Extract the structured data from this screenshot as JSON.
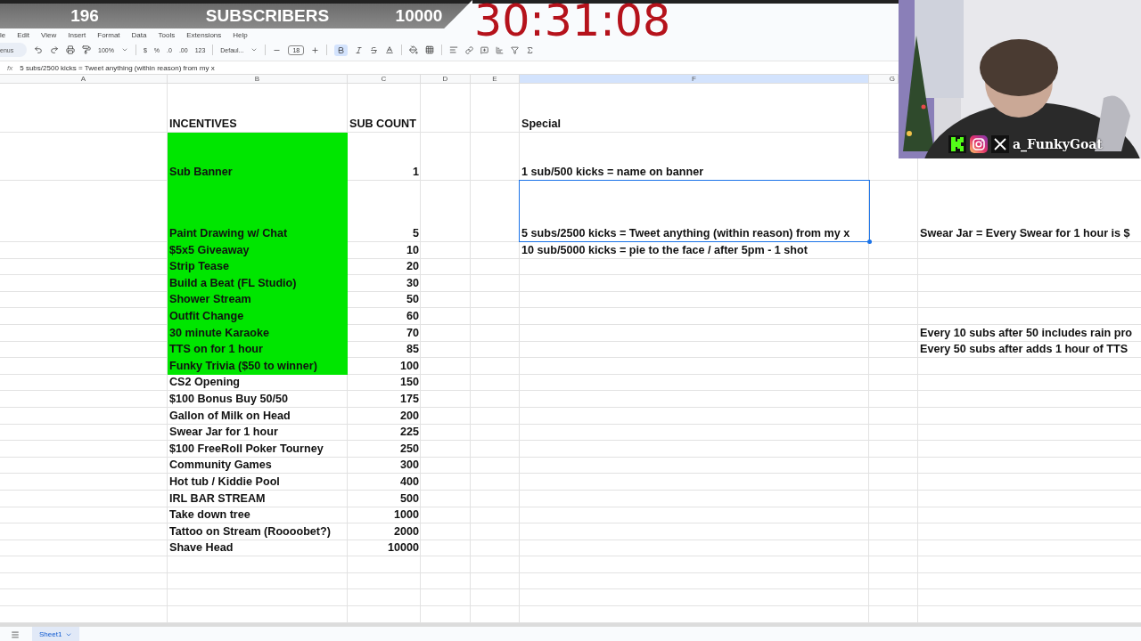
{
  "overlay": {
    "count": "196",
    "label": "SUBSCRIBERS",
    "goal": "10000",
    "timer": "30:31:08"
  },
  "menu": [
    "le",
    "Edit",
    "View",
    "Insert",
    "Format",
    "Data",
    "Tools",
    "Extensions",
    "Help"
  ],
  "toolbar": {
    "search": "enus",
    "zoom": "100%",
    "currency": "$",
    "percent": "%",
    "decrease_decimals": ".0",
    "increase_decimals": ".00",
    "number_format": "123",
    "font": "Defaul...",
    "font_size": "18",
    "bold": true
  },
  "formula_bar": {
    "fx": "fx",
    "content": "5 subs/2500 kicks = Tweet anything (within reason) from my x"
  },
  "columns": [
    {
      "label": "A",
      "selected": false
    },
    {
      "label": "B",
      "selected": false
    },
    {
      "label": "C",
      "selected": false
    },
    {
      "label": "D",
      "selected": false
    },
    {
      "label": "E",
      "selected": false
    },
    {
      "label": "F",
      "selected": true
    },
    {
      "label": "G",
      "selected": false
    }
  ],
  "rows": [
    {
      "kind": "header",
      "incentive": "INCENTIVES",
      "sub_count": "SUB COUNT",
      "special": "Special",
      "highlighted": false,
      "selected": false
    },
    {
      "kind": "banner",
      "incentive": "Sub Banner",
      "sub_count": "1",
      "special": "1 sub/500 kicks = name on banner",
      "highlighted": true,
      "selected": false
    },
    {
      "kind": "tall",
      "incentive": "Paint Drawing w/ Chat",
      "sub_count": "5",
      "special": "5 subs/2500 kicks = Tweet anything (within reason) from my x",
      "note": "Swear Jar = Every Swear for 1 hour is $",
      "highlighted": true,
      "selected": true
    },
    {
      "kind": "item",
      "incentive": "$5x5 Giveaway",
      "sub_count": "10",
      "special": "10 sub/5000 kicks = pie to the face / after 5pm - 1 shot",
      "highlighted": true,
      "selected": false
    },
    {
      "kind": "item",
      "incentive": "Strip Tease",
      "sub_count": "20",
      "highlighted": true,
      "selected": false
    },
    {
      "kind": "item",
      "incentive": "Build a Beat (FL Studio)",
      "sub_count": "30",
      "highlighted": true,
      "selected": false
    },
    {
      "kind": "item",
      "incentive": "Shower Stream",
      "sub_count": "50",
      "highlighted": true,
      "selected": false
    },
    {
      "kind": "item",
      "incentive": "Outfit Change",
      "sub_count": "60",
      "highlighted": true,
      "selected": false
    },
    {
      "kind": "item",
      "incentive": "30 minute Karaoke",
      "sub_count": "70",
      "note": "Every 10 subs after 50 includes rain pro",
      "highlighted": true,
      "selected": false
    },
    {
      "kind": "item",
      "incentive": "TTS on for 1 hour",
      "sub_count": "85",
      "note": "Every 50 subs after adds 1 hour of TTS",
      "highlighted": true,
      "selected": false
    },
    {
      "kind": "item",
      "incentive": "Funky Trivia ($50 to winner)",
      "sub_count": "100",
      "highlighted": true,
      "selected": false
    },
    {
      "kind": "item",
      "incentive": "CS2 Opening",
      "sub_count": "150",
      "highlighted": false,
      "selected": false
    },
    {
      "kind": "item",
      "incentive": "$100 Bonus Buy 50/50",
      "sub_count": "175",
      "highlighted": false,
      "selected": false
    },
    {
      "kind": "item",
      "incentive": "Gallon of Milk on Head",
      "sub_count": "200",
      "highlighted": false,
      "selected": false
    },
    {
      "kind": "item",
      "incentive": "Swear Jar for 1 hour",
      "sub_count": "225",
      "highlighted": false,
      "selected": false
    },
    {
      "kind": "item",
      "incentive": "$100 FreeRoll Poker Tourney",
      "sub_count": "250",
      "highlighted": false,
      "selected": false
    },
    {
      "kind": "item",
      "incentive": "Community Games",
      "sub_count": "300",
      "highlighted": false,
      "selected": false
    },
    {
      "kind": "item",
      "incentive": "Hot tub / Kiddie Pool",
      "sub_count": "400",
      "highlighted": false,
      "selected": false
    },
    {
      "kind": "item",
      "incentive": "IRL BAR STREAM",
      "sub_count": "500",
      "highlighted": false,
      "selected": false
    },
    {
      "kind": "item",
      "incentive": "Take down tree",
      "sub_count": "1000",
      "highlighted": false,
      "selected": false
    },
    {
      "kind": "item",
      "incentive": "Tattoo on Stream (Roooobet?)",
      "sub_count": "2000",
      "highlighted": false,
      "selected": false
    },
    {
      "kind": "item",
      "incentive": "Shave Head",
      "sub_count": "10000",
      "highlighted": false,
      "selected": false
    }
  ],
  "webcam": {
    "kind": "picture",
    "handle": "a_FunkyGoat"
  },
  "sheet_tabs": [
    {
      "label": "Sheet1",
      "selected": true
    }
  ]
}
